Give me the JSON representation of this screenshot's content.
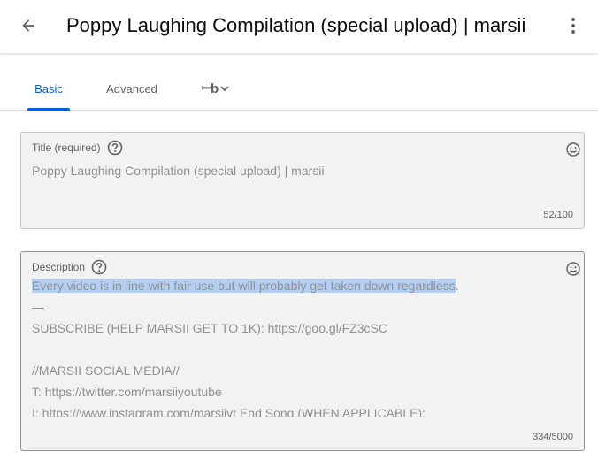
{
  "header": {
    "title": "Poppy Laughing Compilation (special upload) | marsii",
    "back_icon": "arrow-back-icon",
    "more_icon": "more-vert-icon"
  },
  "tabs": [
    {
      "label": "Basic",
      "selected": true
    },
    {
      "label": "Advanced",
      "selected": false
    },
    {
      "label": "",
      "icon": "translate-icon"
    }
  ],
  "title_field": {
    "label": "Title (required)",
    "value": "Poppy Laughing Compilation (special upload) | marsii",
    "count": "52/100"
  },
  "description_field": {
    "label": "Description",
    "selected_text": "Every video is in line with fair use but will probably get taken down regardless",
    "selected_tail": ".",
    "rest": "\n—\nSUBSCRIBE (HELP MARSII GET TO 1K): https://goo.gl/FZ3cSC\n\n//MARSII SOCIAL MEDIA//\nT: https://twitter.com/marsiiyoutube\nI: https://www.instagram.com/marsiiyt End Song (WHEN APPLICABLE):",
    "count": "334/5000"
  },
  "colors": {
    "accent": "#065fd4",
    "selection": "#b4cff4",
    "field_bg": "#f2f2f2"
  }
}
